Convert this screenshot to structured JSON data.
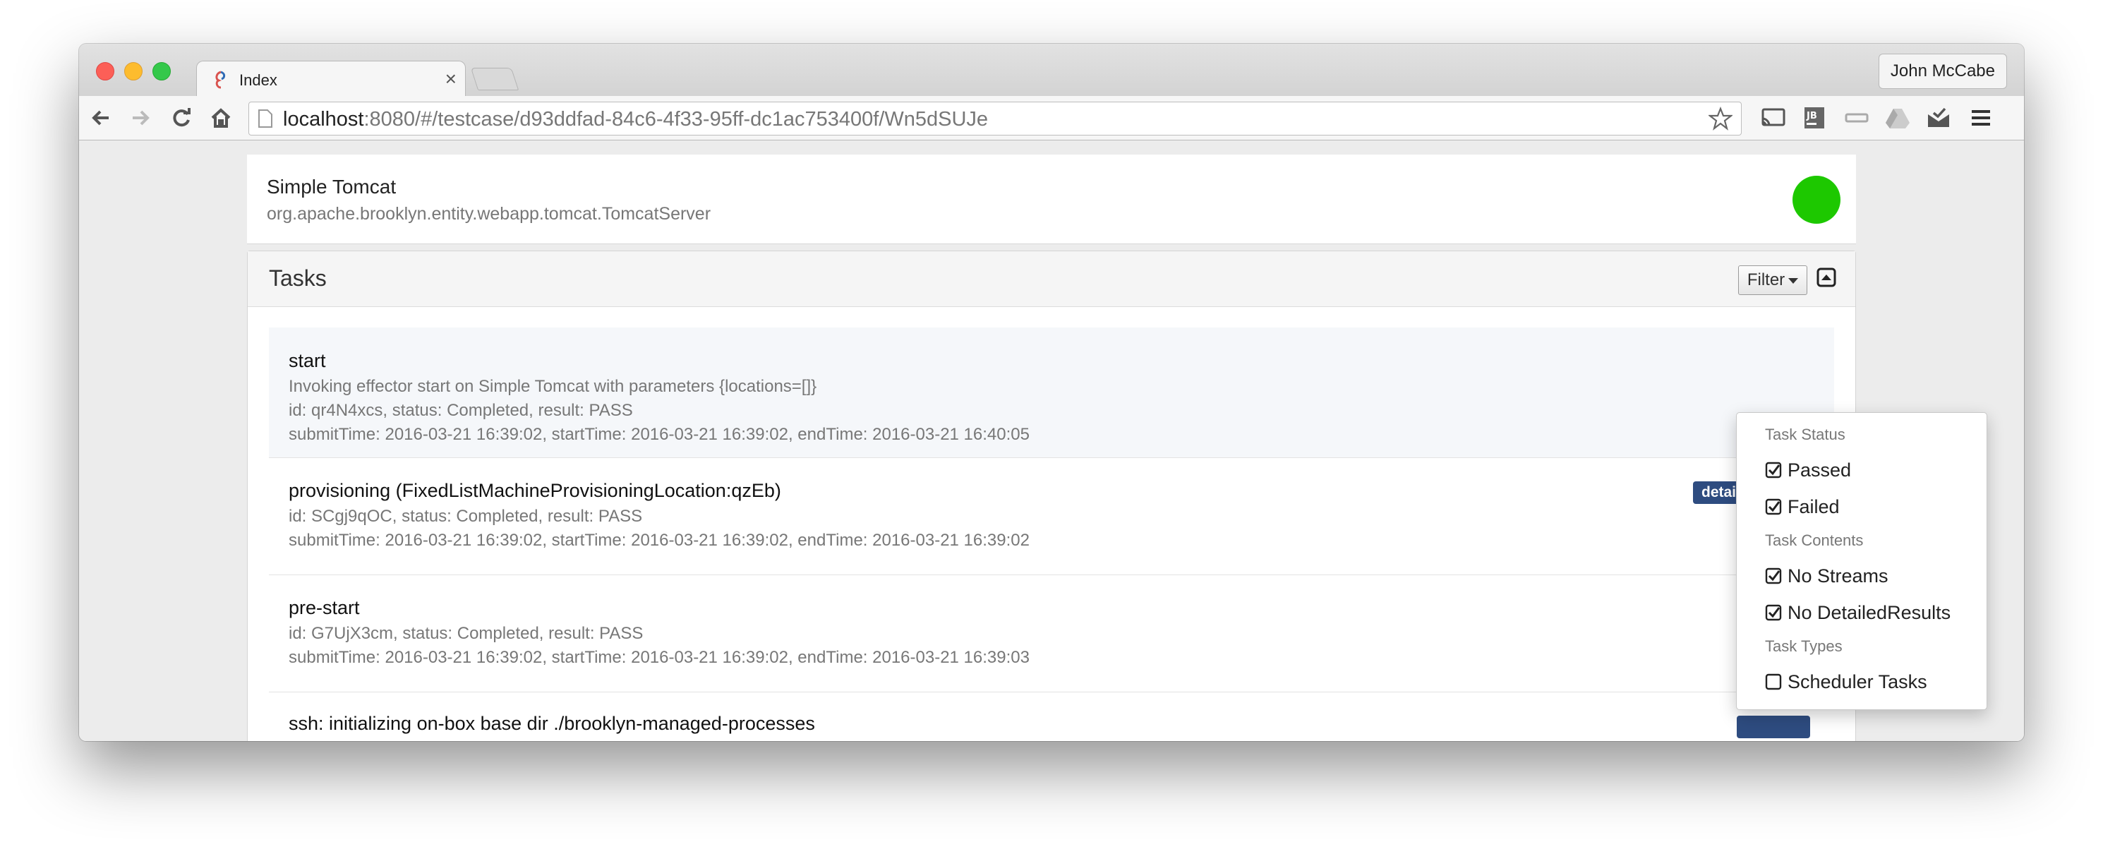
{
  "browser": {
    "tab_title": "Index",
    "tab_close": "×",
    "profile_name": "John McCabe",
    "url_host": "localhost",
    "url_rest": ":8080/#/testcase/d93ddfad-84c6-4f33-95ff-dc1ac753400f/Wn5dSUJe"
  },
  "entity": {
    "name": "Simple Tomcat",
    "type": "org.apache.brooklyn.entity.webapp.tomcat.TomcatServer",
    "status_color": "#1dc800"
  },
  "tasks_panel": {
    "title": "Tasks",
    "filter_label": "Filter",
    "tasks": [
      {
        "name": "start",
        "description": "Invoking effector start on Simple Tomcat with parameters {locations=[]}",
        "meta": "id: qr4N4xcs, status: Completed, result: PASS",
        "times": "submitTime: 2016-03-21 16:39:02, startTime: 2016-03-21 16:39:02, endTime: 2016-03-21 16:40:05"
      },
      {
        "name": "provisioning (FixedListMachineProvisioningLocation:qzEb)",
        "meta": "id: SCgj9qOC, status: Completed, result: PASS",
        "times": "submitTime: 2016-03-21 16:39:02, startTime: 2016-03-21 16:39:02, endTime: 2016-03-21 16:39:02",
        "badge": "detai"
      },
      {
        "name": "pre-start",
        "meta": "id: G7UjX3cm, status: Completed, result: PASS",
        "times": "submitTime: 2016-03-21 16:39:02, startTime: 2016-03-21 16:39:02, endTime: 2016-03-21 16:39:03"
      },
      {
        "name": "ssh: initializing on-box base dir ./brooklyn-managed-processes"
      }
    ]
  },
  "filter_menu": {
    "status_header": "Task Status",
    "passed": "Passed",
    "failed": "Failed",
    "contents_header": "Task Contents",
    "no_streams": "No Streams",
    "no_detailed": "No DetailedResults",
    "types_header": "Task Types",
    "scheduler": "Scheduler Tasks",
    "checked": {
      "passed": true,
      "failed": true,
      "no_streams": true,
      "no_detailed": true,
      "scheduler": false
    }
  }
}
